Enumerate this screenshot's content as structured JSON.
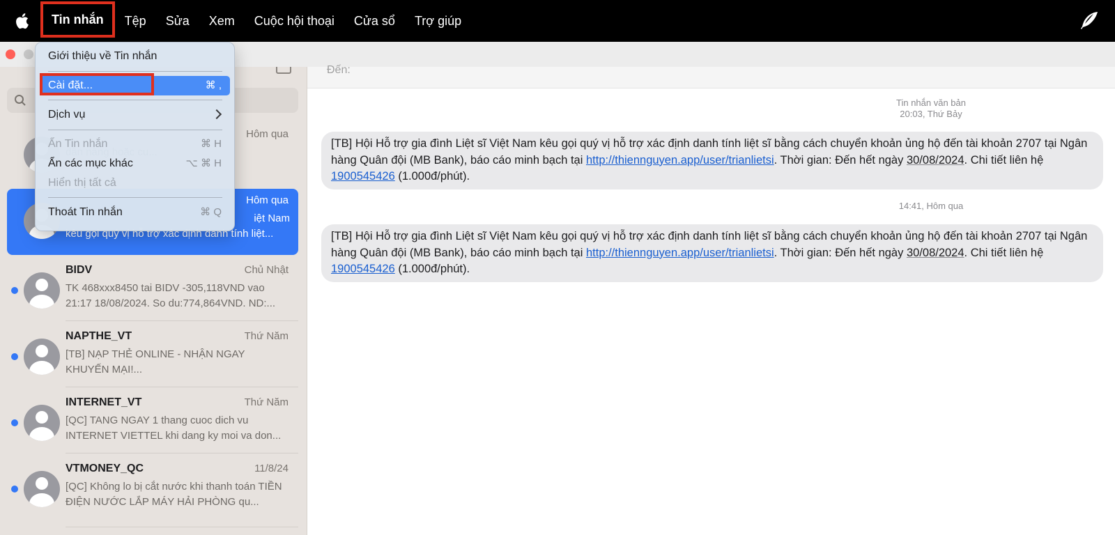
{
  "menubar": {
    "items": [
      {
        "label": "Tin nhắn"
      },
      {
        "label": "Tệp"
      },
      {
        "label": "Sửa"
      },
      {
        "label": "Xem"
      },
      {
        "label": "Cuộc hội thoại"
      },
      {
        "label": "Cửa sổ"
      },
      {
        "label": "Trợ giúp"
      }
    ]
  },
  "dropdown": {
    "about": "Giới thiệu về Tin nhắn",
    "settings": {
      "label": "Cài đặt...",
      "shortcut": "⌘ ,"
    },
    "services": "Dịch vụ",
    "hide": {
      "label": "Ẩn Tin nhắn",
      "shortcut": "⌘ H"
    },
    "hide_others": {
      "label": "Ẩn các mục khác",
      "shortcut": "⌥ ⌘ H"
    },
    "show_all": "Hiển thị tất cả",
    "quit": {
      "label": "Thoát Tin nhắn",
      "shortcut": "⌘ Q"
    }
  },
  "sidebar": {
    "conversations": [
      {
        "name": "",
        "time": "Hôm qua",
        "preview": "dân nâng hoặc cu..."
      },
      {
        "name": "",
        "time": "Hôm qua",
        "preview_line1": "iệt Nam",
        "preview_line2": "kêu gọi quý vị hỗ trợ xác định danh tính liệt..."
      },
      {
        "name": "BIDV",
        "time": "Chủ Nhật",
        "preview": "TK 468xxx8450 tai BIDV -305,118VND vao 21:17 18/08/2024. So du:774,864VND. ND:..."
      },
      {
        "name": "NAPTHE_VT",
        "time": "Thứ Năm",
        "preview": "[TB] NẠP THẺ ONLINE - NHẬN NGAY KHUYẾN MẠI!..."
      },
      {
        "name": "INTERNET_VT",
        "time": "Thứ Năm",
        "preview": "[QC] TANG NGAY 1 thang cuoc dich vu INTERNET VIETTEL khi dang ky moi va don..."
      },
      {
        "name": "VTMONEY_QC",
        "time": "11/8/24",
        "preview": "[QC] Không lo bị cắt nước khi thanh toán TIỀN ĐIỆN NƯỚC LẮP MÁY HẢI PHÒNG qu..."
      }
    ]
  },
  "chat": {
    "to_label": "Đến:",
    "stamp1_line1": "Tin nhắn văn bản",
    "stamp1_line2": "20:03, Thứ Bảy",
    "stamp2": "14:41, Hôm qua",
    "msg": {
      "part1": "[TB] Hội Hỗ trợ gia đình Liệt sĩ Việt Nam kêu gọi quý vị hỗ trợ xác định danh tính liệt sĩ bằng cách chuyển khoản ủng hộ đến tài khoản 2707 tại Ngân hàng Quân đội (MB Bank), báo cáo minh bạch tại ",
      "link": "http://thiennguyen.app/user/trianlietsi",
      "part2": ". Thời gian: Đến hết ngày ",
      "date": "30/08/2024",
      "part3": ". Chi tiết liên hệ ",
      "phone": "1900545426",
      "part4": " (1.000đ/phút)."
    }
  },
  "colors": {
    "accent": "#3478f6",
    "highlight_box": "#e0301e"
  }
}
